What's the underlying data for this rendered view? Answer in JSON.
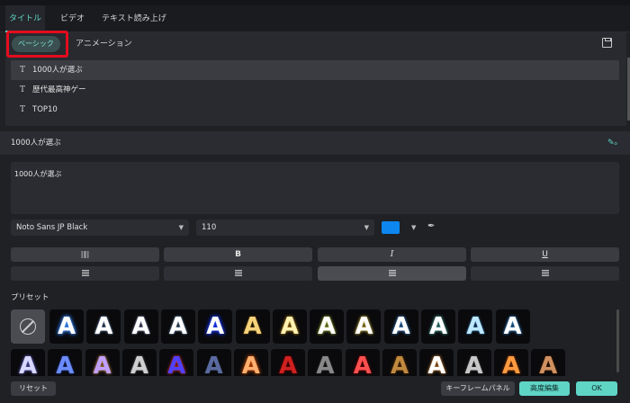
{
  "tabs": [
    "タイトル",
    "ビデオ",
    "テキスト読み上げ"
  ],
  "subtabs": {
    "basic": "ベーシック",
    "animation": "アニメーション"
  },
  "list": [
    "1000人が選ぶ",
    "歴代最高神ゲー",
    "TOP10"
  ],
  "section_title": "1000人が選ぶ",
  "text_value": "1000人が選ぶ",
  "font_family": "Noto Sans JP Black",
  "font_size": "110",
  "text_color": "#0d86f0",
  "style_buttons": {
    "bold": "B",
    "italic": "I",
    "underline": "U"
  },
  "preset_label": "プリセット",
  "preset_letter": "A",
  "footer": {
    "reset": "リセット",
    "keyframe": "キーフレームパネル",
    "advanced": "高度編集",
    "ok": "OK"
  },
  "icons": {
    "save": "save-icon",
    "pen": "pen-icon",
    "title_item": "text-t-icon",
    "picker": "eyedropper-icon",
    "none": "no-preset-icon"
  },
  "accent": "#5fd5c6",
  "highlight": "#e50c1e"
}
